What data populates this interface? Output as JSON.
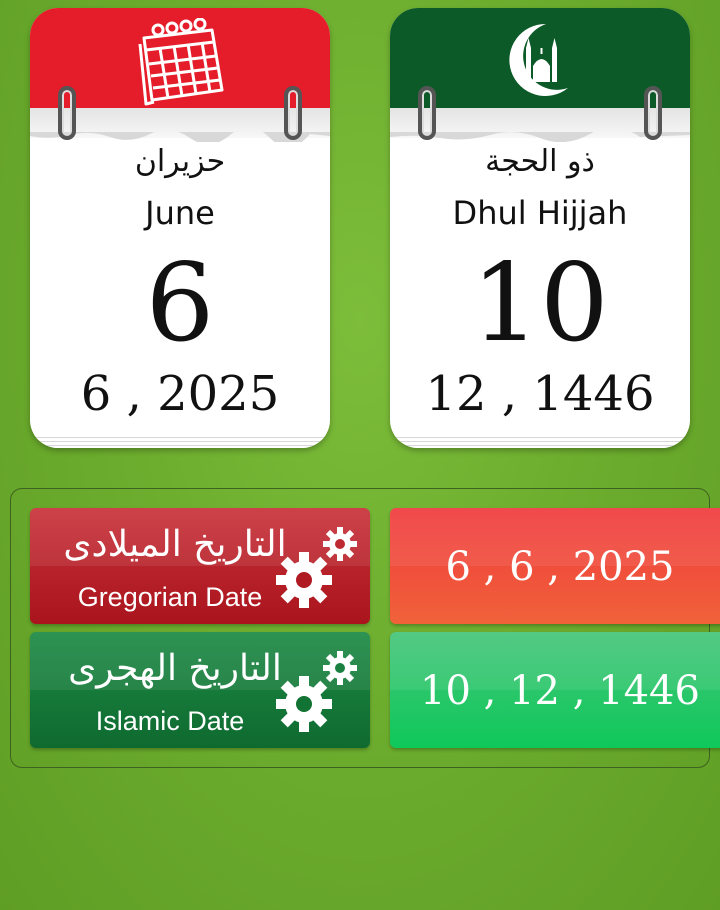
{
  "gregorian_card": {
    "month_ar": "حزيران",
    "month_en": "June",
    "day": "6",
    "date_line": "6 , 2025",
    "header_color": "#e51d2b",
    "icon": "calendar-icon"
  },
  "hijri_card": {
    "month_ar": "ذو الحجة",
    "month_en": "Dhul Hijjah",
    "day": "10",
    "date_line": "12 , 1446",
    "header_color": "#0b5a27",
    "icon": "mosque-crescent-icon"
  },
  "converter": {
    "gregorian": {
      "label_ar": "التاريخ الميلادى",
      "label_en": "Gregorian Date",
      "value": "6 , 6 , 2025",
      "icon": "gears-icon"
    },
    "islamic": {
      "label_ar": "التاريخ الهجرى",
      "label_en": "Islamic Date",
      "value": "10 , 12 , 1446",
      "icon": "gears-icon"
    }
  }
}
